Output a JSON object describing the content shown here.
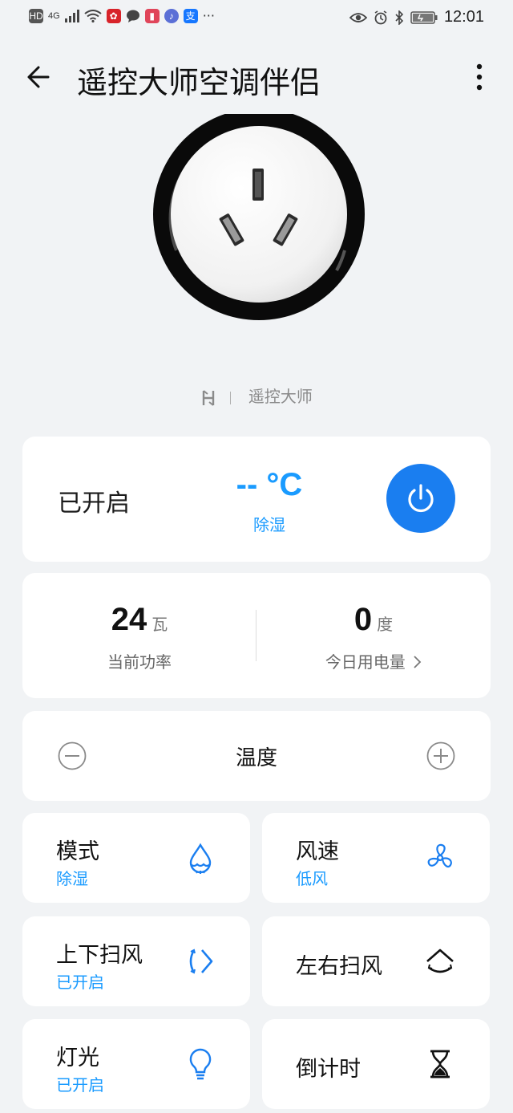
{
  "status_bar": {
    "left_badges": [
      "HD",
      "4G"
    ],
    "time": "12:01"
  },
  "app_bar": {
    "title": "遥控大师空调伴侣"
  },
  "brand": {
    "name": "遥控大师"
  },
  "status_card": {
    "state": "已开启",
    "temperature": "-- °C",
    "mode": "除湿"
  },
  "stats": {
    "power_value": "24",
    "power_unit": "瓦",
    "power_label": "当前功率",
    "energy_value": "0",
    "energy_unit": "度",
    "energy_label": "今日用电量"
  },
  "temperature_control": {
    "label": "温度"
  },
  "tiles": {
    "mode": {
      "title": "模式",
      "value": "除湿",
      "icon": "water-drop-icon"
    },
    "fan": {
      "title": "风速",
      "value": "低风",
      "icon": "fan-icon"
    },
    "swing_vertical": {
      "title": "上下扫风",
      "value": "已开启",
      "icon": "vertical-swing-icon"
    },
    "swing_horizontal": {
      "title": "左右扫风",
      "icon": "horizontal-swing-icon"
    },
    "light": {
      "title": "灯光",
      "value": "已开启",
      "icon": "light-bulb-icon"
    },
    "timer": {
      "title": "倒计时",
      "icon": "hourglass-icon"
    }
  },
  "colors": {
    "accent": "#1a9bff",
    "power_button": "#1a7ef0",
    "background": "#f1f3f5"
  }
}
